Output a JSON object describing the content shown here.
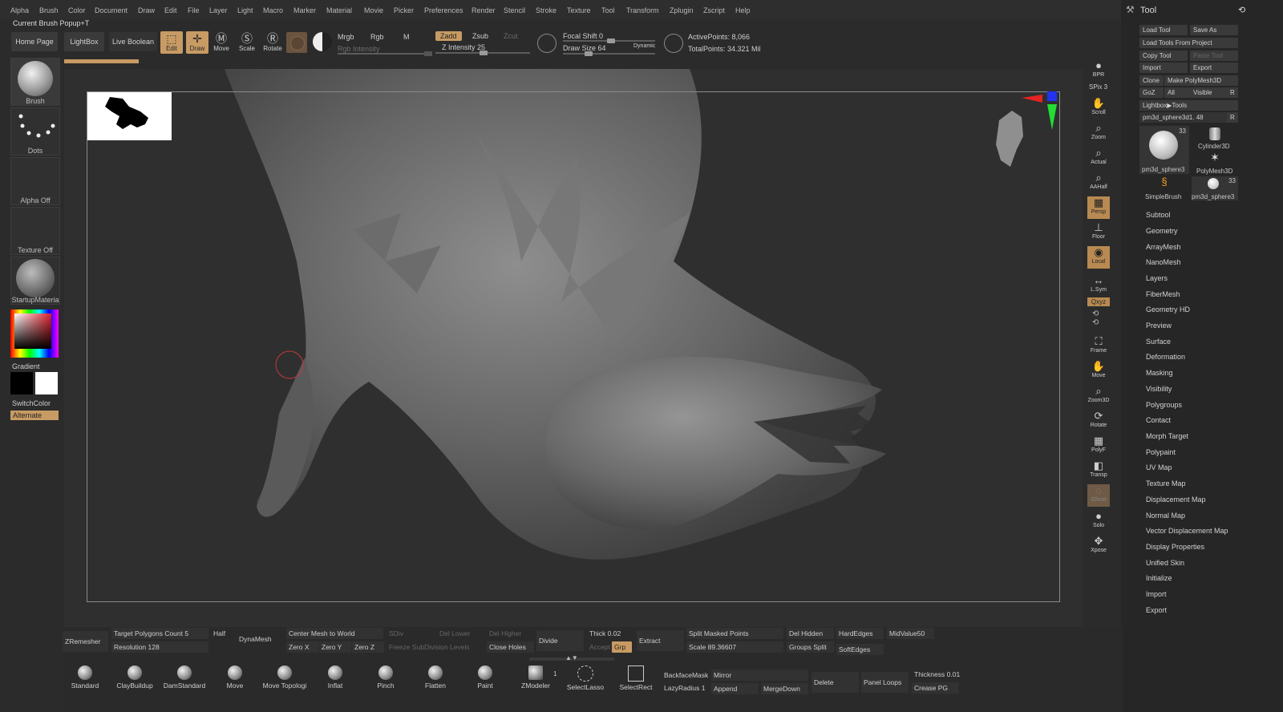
{
  "menus": [
    "Alpha",
    "Brush",
    "Color",
    "Document",
    "Draw",
    "Edit",
    "File",
    "Layer",
    "Light",
    "Macro",
    "Marker",
    "Material",
    "Movie",
    "Picker",
    "Preferences",
    "Render",
    "Stencil",
    "Stroke",
    "Texture",
    "Tool",
    "Transform",
    "Zplugin",
    "Zscript",
    "Help"
  ],
  "brush_popup": "Current Brush Popup+T",
  "toolbar": {
    "home_page": "Home Page",
    "lightbox": "LightBox",
    "live_boolean": "Live Boolean",
    "edit": "Edit",
    "draw": "Draw",
    "move": "Move",
    "scale": "Scale",
    "rotate": "Rotate",
    "mrgb": "Mrgb",
    "rgb": "Rgb",
    "m": "M",
    "rgb_intensity": "Rgb Intensity",
    "zadd": "Zadd",
    "zsub": "Zsub",
    "zcut": "Zcut",
    "z_intensity": "Z Intensity 25",
    "focal_shift": "Focal Shift 0",
    "draw_size": "Draw Size 64",
    "dynamic": "Dynamic",
    "active_points": "ActivePoints: 8,066",
    "total_points": "TotalPoints: 34.321 Mil"
  },
  "left_shelf": {
    "brush": "Brush",
    "dots": "Dots",
    "alpha_off": "Alpha Off",
    "texture_off": "Texture Off",
    "material": "StartupMateria",
    "gradient": "Gradient",
    "switch_color": "SwitchColor",
    "alternate": "Alternate"
  },
  "right_shelf": [
    "BPR",
    "SPix 3",
    "Scroll",
    "Zoom",
    "Actual",
    "AAHalf",
    "Persp",
    "Floor",
    "Local",
    "L.Sym",
    "Qxyz",
    "Frame",
    "Move",
    "Zoom3D",
    "Rotate",
    "PolyF",
    "Transp",
    "Ghost",
    "Solo",
    "Xpose"
  ],
  "tool_panel": {
    "title": "Tool",
    "load_tool": "Load Tool",
    "save_as": "Save As",
    "load_from_project": "Load Tools From Project",
    "copy_tool": "Copy Tool",
    "paste_tool": "Paste Tool",
    "import": "Import",
    "export": "Export",
    "clone": "Clone",
    "make_polymesh": "Make PolyMesh3D",
    "goz": "GoZ",
    "all": "All",
    "visible": "Visible",
    "r": "R",
    "lightbox_tools": "Lightbox▶Tools",
    "current_tool": "pm3d_sphere3d1. 48",
    "thumbs": [
      {
        "label": "pm3d_sphere3",
        "count": "33"
      },
      {
        "label": "Cylinder3D",
        "count": ""
      },
      {
        "label": "PolyMesh3D",
        "count": ""
      },
      {
        "label": "SimpleBrush",
        "count": ""
      },
      {
        "label": "pm3d_sphere3",
        "count": "33"
      }
    ],
    "menu": [
      "Subtool",
      "Geometry",
      "ArrayMesh",
      "NanoMesh",
      "Layers",
      "FiberMesh",
      "Geometry HD",
      "Preview",
      "Surface",
      "Deformation",
      "Masking",
      "Visibility",
      "Polygroups",
      "Contact",
      "Morph Target",
      "Polypaint",
      "UV Map",
      "Texture Map",
      "Displacement Map",
      "Normal Map",
      "Vector Displacement Map",
      "Display Properties",
      "Unified Skin",
      "Initialize",
      "Import",
      "Export"
    ]
  },
  "bottom": {
    "zremesher": "ZRemesher",
    "target_polygons": "Target Polygons Count 5",
    "half": "Half",
    "resolution": "Resolution 128",
    "dynamesh": "DynaMesh",
    "center_mesh": "Center Mesh to World",
    "sdiv": "SDiv",
    "del_lower": "Del Lower",
    "del_higher": "Del Higher",
    "zero_x": "Zero X",
    "zero_y": "Zero Y",
    "zero_z": "Zero Z",
    "freeze": "Freeze SubDivision Levels",
    "close_holes": "Close Holes",
    "divide": "Divide",
    "thick": "Thick 0.02",
    "accept": "Accept",
    "grp": "Grp",
    "extract": "Extract",
    "split_masked": "Split Masked Points",
    "scale": "Scale 89.36607",
    "del_hidden": "Del Hidden",
    "groups_split": "Groups Split",
    "hard_edges": "HardEdges",
    "soft_edges": "SoftEdges",
    "midvalue": "MidValue50",
    "brushes": [
      "Standard",
      "ClayBuildup",
      "DamStandard",
      "Move",
      "Move Topologi",
      "Inflat",
      "Pinch",
      "Flatten",
      "Paint",
      "ZModeler",
      "SelectLasso",
      "SelectRect"
    ],
    "zmodeler_count": "1",
    "backface_mask": "BackfaceMask",
    "mirror": "Mirror",
    "lazy_radius": "LazyRadius 1",
    "append": "Append",
    "merge_down": "MergeDown",
    "delete": "Delete",
    "panel_loops": "Panel Loops",
    "thickness": "Thickness 0.01",
    "crease_pg": "Crease PG"
  }
}
